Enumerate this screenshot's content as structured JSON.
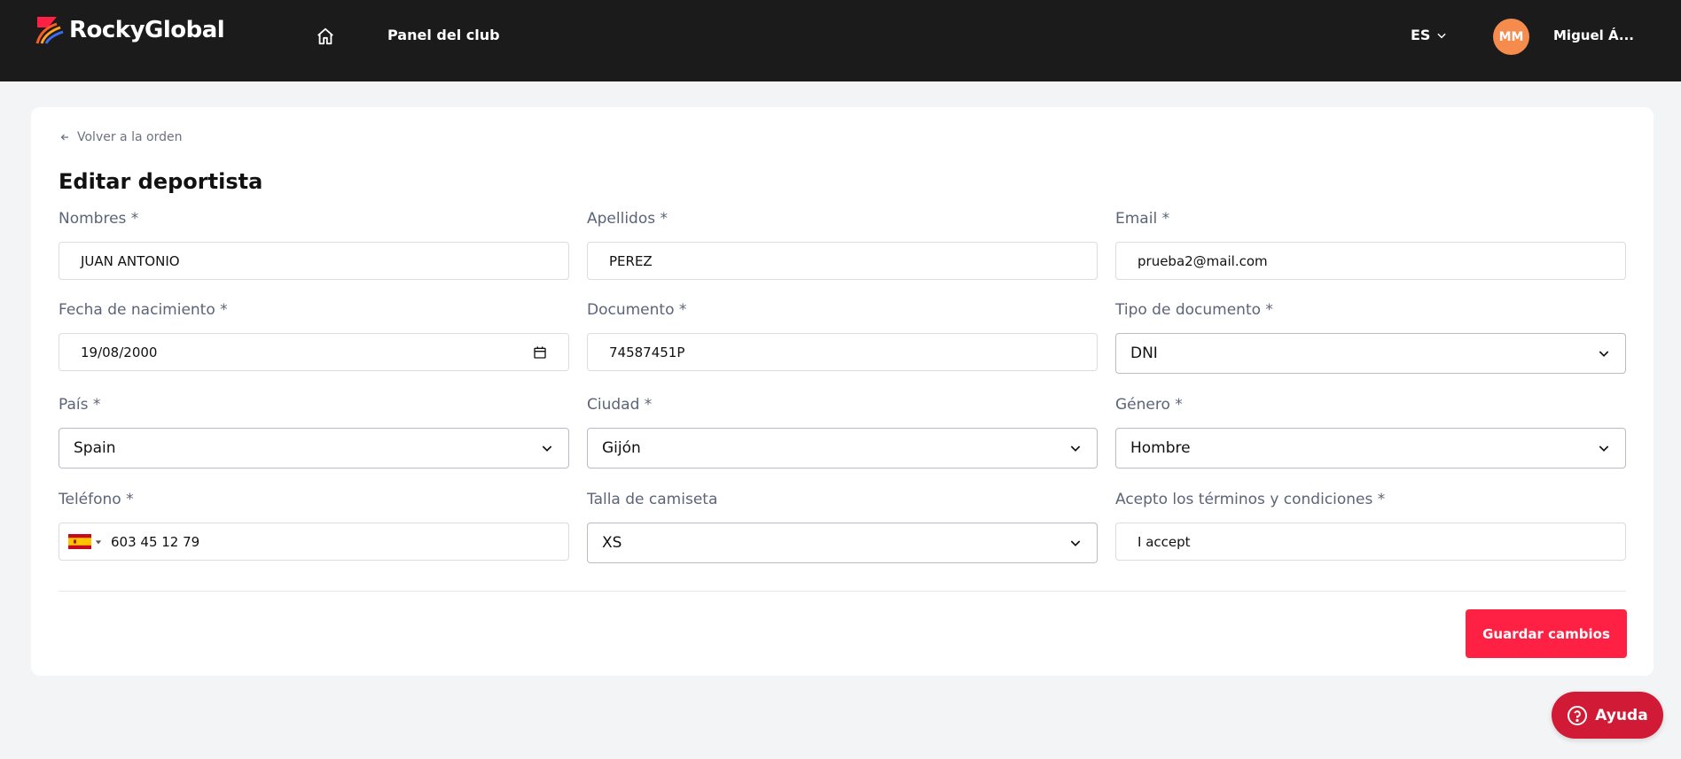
{
  "header": {
    "brand": "RockyGlobal",
    "nav_link": "Panel del club",
    "language": "ES",
    "avatar_initials": "MM",
    "user_name": "Miguel Á..."
  },
  "page": {
    "back_link": "Volver a la orden",
    "title": "Editar deportista"
  },
  "fields": {
    "nombres": {
      "label": "Nombres *",
      "value": "JUAN ANTONIO"
    },
    "apellidos": {
      "label": "Apellidos *",
      "value": "PEREZ"
    },
    "email": {
      "label": "Email *",
      "value": "prueba2@mail.com"
    },
    "fecha": {
      "label": "Fecha de nacimiento *",
      "value": "19/08/2000"
    },
    "documento": {
      "label": "Documento *",
      "value": "74587451P"
    },
    "tipo_documento": {
      "label": "Tipo de documento *",
      "value": "DNI"
    },
    "pais": {
      "label": "País *",
      "value": "Spain"
    },
    "ciudad": {
      "label": "Ciudad *",
      "value": "Gijón"
    },
    "genero": {
      "label": "Género *",
      "value": "Hombre"
    },
    "telefono": {
      "label": "Teléfono *",
      "value": "603 45 12 79"
    },
    "talla": {
      "label": "Talla de camiseta",
      "value": "XS"
    },
    "terminos": {
      "label": "Acepto los términos y condiciones *",
      "value": "I accept"
    }
  },
  "actions": {
    "save": "Guardar cambios",
    "help": "Ayuda"
  },
  "colors": {
    "topbar": "#1b1b1b",
    "accent": "#ff2143",
    "help": "#d11a35",
    "avatar": "#f58b4c"
  }
}
